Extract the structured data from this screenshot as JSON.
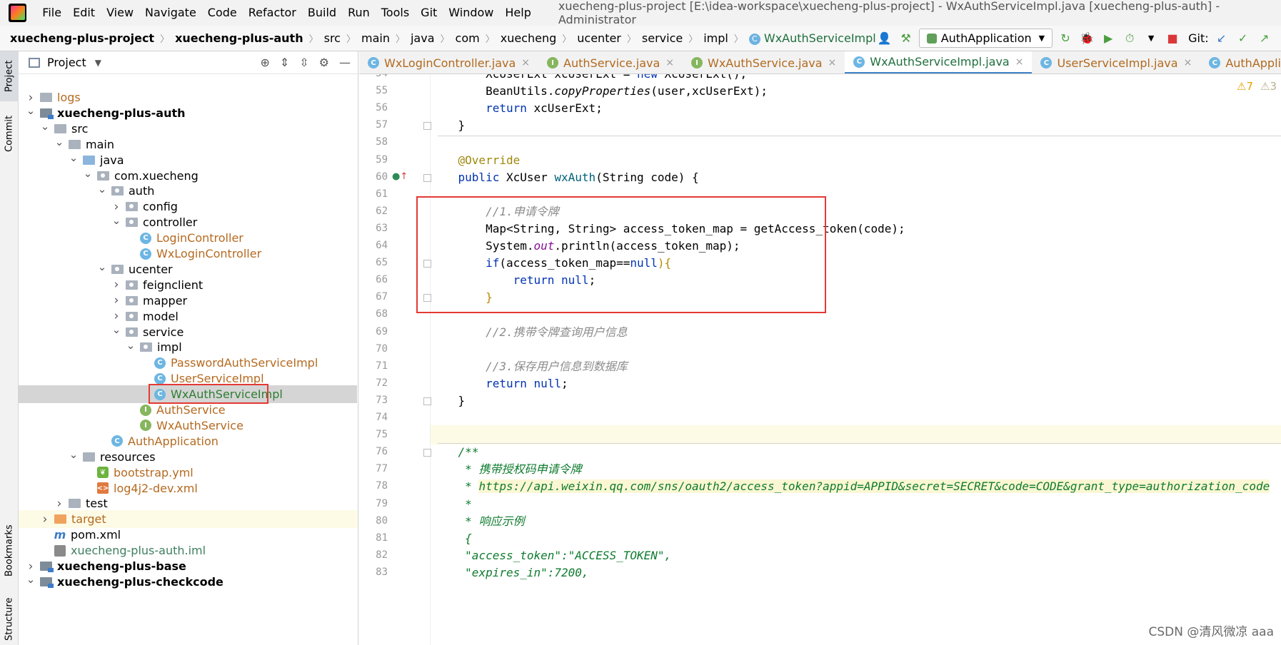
{
  "menubar": {
    "items": [
      "File",
      "Edit",
      "View",
      "Navigate",
      "Code",
      "Refactor",
      "Build",
      "Run",
      "Tools",
      "Git",
      "Window",
      "Help"
    ],
    "window_title": "xuecheng-plus-project [E:\\idea-workspace\\xuecheng-plus-project] - WxAuthServiceImpl.java [xuecheng-plus-auth] - Administrator"
  },
  "breadcrumb": [
    "xuecheng-plus-project",
    "xuecheng-plus-auth",
    "src",
    "main",
    "java",
    "com",
    "xuecheng",
    "ucenter",
    "service",
    "impl",
    "WxAuthServiceImpl"
  ],
  "toolbar": {
    "run_config": "AuthApplication",
    "git_label": "Git:"
  },
  "left_strip": [
    "Project",
    "Commit",
    "Bookmarks",
    "Structure"
  ],
  "project_panel": {
    "title": "Project"
  },
  "tree": [
    {
      "label": "logs",
      "depth": 1,
      "arrow": "right",
      "icon": "folder",
      "style": "orange"
    },
    {
      "label": "xuecheng-plus-auth",
      "depth": 1,
      "arrow": "down",
      "icon": "module",
      "style": "bold"
    },
    {
      "label": "src",
      "depth": 2,
      "arrow": "down",
      "icon": "folder"
    },
    {
      "label": "main",
      "depth": 3,
      "arrow": "down",
      "icon": "folder"
    },
    {
      "label": "java",
      "depth": 4,
      "arrow": "down",
      "icon": "folder-blue"
    },
    {
      "label": "com.xuecheng",
      "depth": 5,
      "arrow": "down",
      "icon": "package"
    },
    {
      "label": "auth",
      "depth": 6,
      "arrow": "down",
      "icon": "package"
    },
    {
      "label": "config",
      "depth": 7,
      "arrow": "right",
      "icon": "package"
    },
    {
      "label": "controller",
      "depth": 7,
      "arrow": "down",
      "icon": "package"
    },
    {
      "label": "LoginController",
      "depth": 8,
      "arrow": "none",
      "icon": "class",
      "style": "orange"
    },
    {
      "label": "WxLoginController",
      "depth": 8,
      "arrow": "none",
      "icon": "class",
      "style": "orange"
    },
    {
      "label": "ucenter",
      "depth": 6,
      "arrow": "down",
      "icon": "package"
    },
    {
      "label": "feignclient",
      "depth": 7,
      "arrow": "right",
      "icon": "package"
    },
    {
      "label": "mapper",
      "depth": 7,
      "arrow": "right",
      "icon": "package"
    },
    {
      "label": "model",
      "depth": 7,
      "arrow": "right",
      "icon": "package"
    },
    {
      "label": "service",
      "depth": 7,
      "arrow": "down",
      "icon": "package"
    },
    {
      "label": "impl",
      "depth": 8,
      "arrow": "down",
      "icon": "package"
    },
    {
      "label": "PasswordAuthServiceImpl",
      "depth": 9,
      "arrow": "none",
      "icon": "class",
      "style": "orange"
    },
    {
      "label": "UserServiceImpl",
      "depth": 9,
      "arrow": "none",
      "icon": "class",
      "style": "orange"
    },
    {
      "label": "WxAuthServiceImpl",
      "depth": 9,
      "arrow": "none",
      "icon": "class",
      "style": "green",
      "selected": true
    },
    {
      "label": "AuthService",
      "depth": 8,
      "arrow": "none",
      "icon": "interface",
      "style": "orange"
    },
    {
      "label": "WxAuthService",
      "depth": 8,
      "arrow": "none",
      "icon": "interface",
      "style": "orange"
    },
    {
      "label": "AuthApplication",
      "depth": 6,
      "arrow": "none",
      "icon": "app",
      "style": "orange"
    },
    {
      "label": "resources",
      "depth": 4,
      "arrow": "down",
      "icon": "folder-res"
    },
    {
      "label": "bootstrap.yml",
      "depth": 5,
      "arrow": "none",
      "icon": "yml",
      "style": "orange"
    },
    {
      "label": "log4j2-dev.xml",
      "depth": 5,
      "arrow": "none",
      "icon": "xml",
      "style": "orange"
    },
    {
      "label": "test",
      "depth": 3,
      "arrow": "right",
      "icon": "folder"
    },
    {
      "label": "target",
      "depth": 2,
      "arrow": "right",
      "icon": "folder-orange",
      "style": "orange",
      "highlight": true
    },
    {
      "label": "pom.xml",
      "depth": 2,
      "arrow": "none",
      "icon": "maven"
    },
    {
      "label": "xuecheng-plus-auth.iml",
      "depth": 2,
      "arrow": "none",
      "icon": "iml",
      "style": "greenish"
    },
    {
      "label": "xuecheng-plus-base",
      "depth": 1,
      "arrow": "right",
      "icon": "module",
      "style": "bold"
    },
    {
      "label": "xuecheng-plus-checkcode",
      "depth": 1,
      "arrow": "down",
      "icon": "module",
      "style": "bold"
    }
  ],
  "editor_tabs": [
    {
      "label": "WxLoginController.java",
      "kind": "c"
    },
    {
      "label": "AuthService.java",
      "kind": "i"
    },
    {
      "label": "WxAuthService.java",
      "kind": "i"
    },
    {
      "label": "WxAuthServiceImpl.java",
      "kind": "c",
      "active": true
    },
    {
      "label": "UserServiceImpl.java",
      "kind": "c"
    },
    {
      "label": "AuthApplication.java",
      "kind": "c"
    }
  ],
  "inspections": {
    "warnings": "7",
    "weak": "3"
  },
  "code": {
    "first_line": 54,
    "lines": [
      [
        {
          "t": "        XcUserExt xcUserExt = "
        },
        {
          "t": "new",
          "c": "kw"
        },
        {
          "t": " XcUserExt();"
        }
      ],
      [
        {
          "t": "        BeanUtils."
        },
        {
          "t": "copyProperties",
          "c": "italic"
        },
        {
          "t": "(user,xcUserExt);"
        }
      ],
      [
        {
          "t": "        "
        },
        {
          "t": "return",
          "c": "kw"
        },
        {
          "t": " xcUserExt;"
        }
      ],
      [
        {
          "t": "    }"
        }
      ],
      [
        {
          "t": ""
        }
      ],
      [
        {
          "t": "    "
        },
        {
          "t": "@Override",
          "c": "ann"
        }
      ],
      [
        {
          "t": "    "
        },
        {
          "t": "public",
          "c": "kw"
        },
        {
          "t": " XcUser "
        },
        {
          "t": "wxAuth",
          "c": "fn"
        },
        {
          "t": "(String code) {"
        }
      ],
      [
        {
          "t": ""
        }
      ],
      [
        {
          "t": "        "
        },
        {
          "t": "//1.申请令牌",
          "c": "cm"
        }
      ],
      [
        {
          "t": "        Map<String, String> access_token_map = getAccess_token(code);"
        }
      ],
      [
        {
          "t": "        System."
        },
        {
          "t": "out",
          "c": "fld"
        },
        {
          "t": ".println(access_token_map);"
        }
      ],
      [
        {
          "t": "        "
        },
        {
          "t": "if",
          "c": "kw"
        },
        {
          "t": "(access_token_map=="
        },
        {
          "t": "null",
          "c": "kw"
        },
        {
          "t": "){",
          "c": "br"
        }
      ],
      [
        {
          "t": "            "
        },
        {
          "t": "return",
          "c": "kw"
        },
        {
          "t": " "
        },
        {
          "t": "null",
          "c": "kw"
        },
        {
          "t": ";"
        }
      ],
      [
        {
          "t": "        "
        },
        {
          "t": "}",
          "c": "br"
        }
      ],
      [
        {
          "t": ""
        }
      ],
      [
        {
          "t": "        "
        },
        {
          "t": "//2.携带令牌查询用户信息",
          "c": "cm"
        }
      ],
      [
        {
          "t": ""
        }
      ],
      [
        {
          "t": "        "
        },
        {
          "t": "//3.保存用户信息到数据库",
          "c": "cm"
        }
      ],
      [
        {
          "t": "        "
        },
        {
          "t": "return",
          "c": "kw"
        },
        {
          "t": " "
        },
        {
          "t": "null",
          "c": "kw"
        },
        {
          "t": ";"
        }
      ],
      [
        {
          "t": "    }"
        }
      ],
      [
        {
          "t": ""
        }
      ],
      [
        {
          "t": ""
        }
      ],
      [
        {
          "t": "    "
        },
        {
          "t": "/**",
          "c": "doc"
        }
      ],
      [
        {
          "t": "     "
        },
        {
          "t": "* 携带授权码申请令牌",
          "c": "doc"
        }
      ],
      [
        {
          "t": "     "
        },
        {
          "t": "* ",
          "c": "doc"
        },
        {
          "t": "https://api.weixin.qq.com/sns/oauth2/access_token?appid=APPID&secret=SECRET&code=CODE&grant_type=authorization_code",
          "c": "url"
        }
      ],
      [
        {
          "t": "     "
        },
        {
          "t": "*",
          "c": "doc"
        }
      ],
      [
        {
          "t": "     "
        },
        {
          "t": "* 响应示例",
          "c": "doc"
        }
      ],
      [
        {
          "t": "     "
        },
        {
          "t": "{",
          "c": "doc"
        }
      ],
      [
        {
          "t": "     "
        },
        {
          "t": "\"access_token\":\"ACCESS_TOKEN\",",
          "c": "doc"
        }
      ],
      [
        {
          "t": "     "
        },
        {
          "t": "\"expires_in\":7200,",
          "c": "doc"
        }
      ]
    ]
  },
  "watermark": "CSDN @清风微凉 aaa"
}
